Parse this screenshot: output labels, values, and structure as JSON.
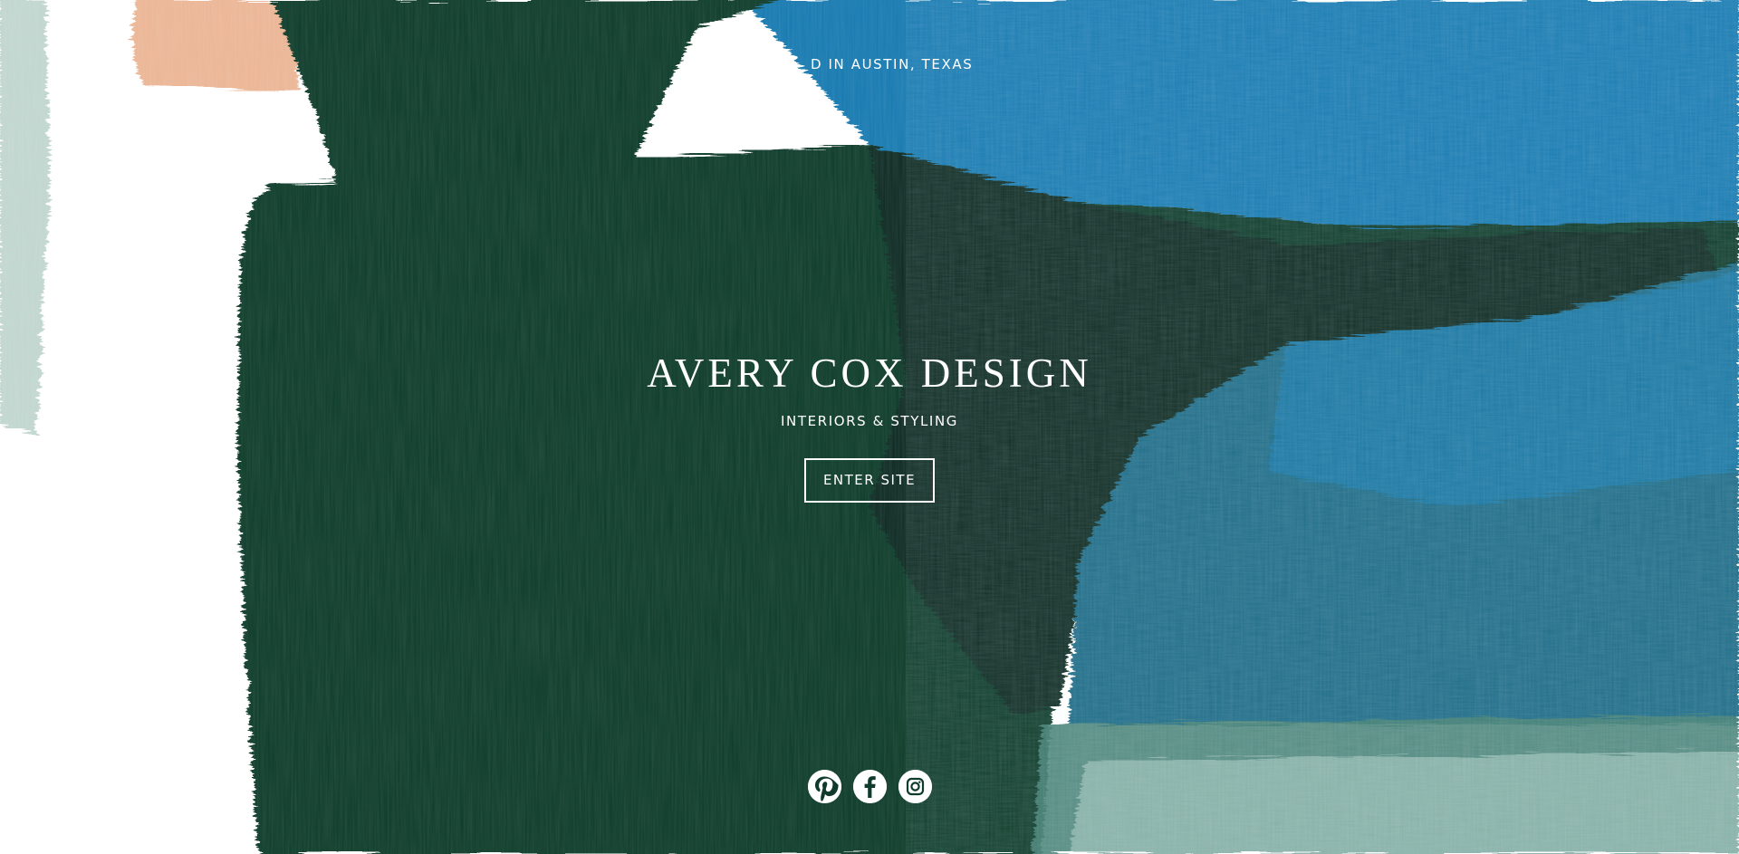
{
  "header": {
    "location_tagline": "D IN AUSTIN, TEXAS"
  },
  "hero": {
    "title": "AVERY COX DESIGN",
    "subtitle": "INTERIORS & STYLING",
    "enter_label": "ENTER SITE"
  },
  "social": {
    "icons": [
      "pinterest-icon",
      "facebook-icon",
      "instagram-icon"
    ]
  },
  "colors": {
    "text": "#ffffff",
    "paint_green_dark": "#0f3a2c",
    "paint_green_deep": "#072a21",
    "paint_blue": "#1479b0",
    "paint_teal": "#1d6a86",
    "paint_peach": "#e8a983"
  }
}
